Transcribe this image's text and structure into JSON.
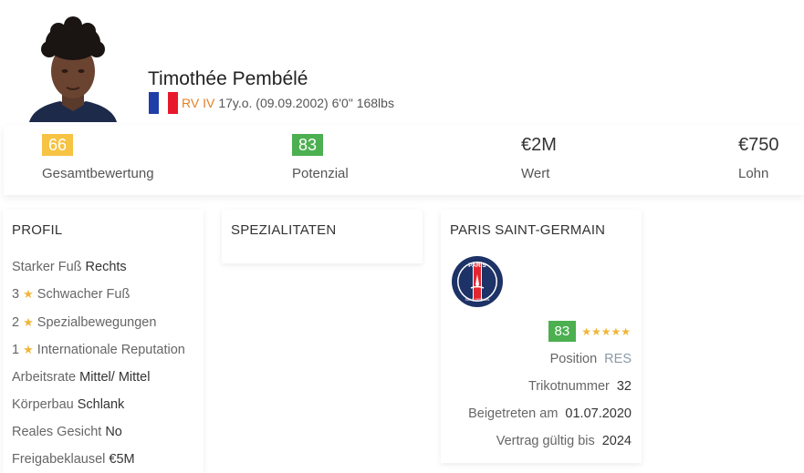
{
  "player": {
    "name": "Timothée Pembélé",
    "positions": "RV IV",
    "info": "17y.o. (09.09.2002) 6'0\" 168lbs",
    "flag_colors": [
      "#1f3ea8",
      "#ffffff",
      "#e8192c"
    ]
  },
  "stats": [
    {
      "value": "66",
      "label": "Gesamtbewertung",
      "badge_color": "#f6c343"
    },
    {
      "value": "83",
      "label": "Potenzial",
      "badge_color": "#4caf50"
    },
    {
      "value": "€2M",
      "label": "Wert"
    },
    {
      "value": "€750",
      "label": "Lohn"
    }
  ],
  "profil": {
    "title": "PROFIL",
    "rows": [
      {
        "prefix": "",
        "label": "Starker Fuß",
        "value": "Rechts"
      },
      {
        "prefix": "3",
        "label": "Schwacher Fuß",
        "value": ""
      },
      {
        "prefix": "2",
        "label": "Spezialbewegungen",
        "value": ""
      },
      {
        "prefix": "1",
        "label": "Internationale Reputation",
        "value": ""
      },
      {
        "prefix": "",
        "label": "Arbeitsrate",
        "value": "Mittel/ Mittel"
      },
      {
        "prefix": "",
        "label": "Körperbau",
        "value": "Schlank"
      },
      {
        "prefix": "",
        "label": "Reales Gesicht",
        "value": "No"
      },
      {
        "prefix": "",
        "label": "Freigabeklausel",
        "value": "€5M"
      }
    ]
  },
  "specialities": {
    "title": "SPEZIALITATEN"
  },
  "club": {
    "title": "PARIS SAINT-GERMAIN",
    "crest_text": "PARIS",
    "crest_subtext": "SAINT-GERMAIN",
    "rating": "83",
    "rating_stars": "★★★★★",
    "rows": [
      {
        "label": "Position",
        "value": "RES"
      },
      {
        "label": "Trikotnummer",
        "value": "32"
      },
      {
        "label": "Beigetreten am",
        "value": "01.07.2020"
      },
      {
        "label": "Vertrag gültig bis",
        "value": "2024"
      }
    ]
  },
  "icons": {
    "star": "star-icon",
    "flag": "france-flag-icon",
    "crest": "psg-crest-icon"
  },
  "colors": {
    "accent_orange": "#e67e22",
    "star_gold": "#f0b63a",
    "badge_green": "#4caf50",
    "badge_yellow": "#f6c343"
  }
}
